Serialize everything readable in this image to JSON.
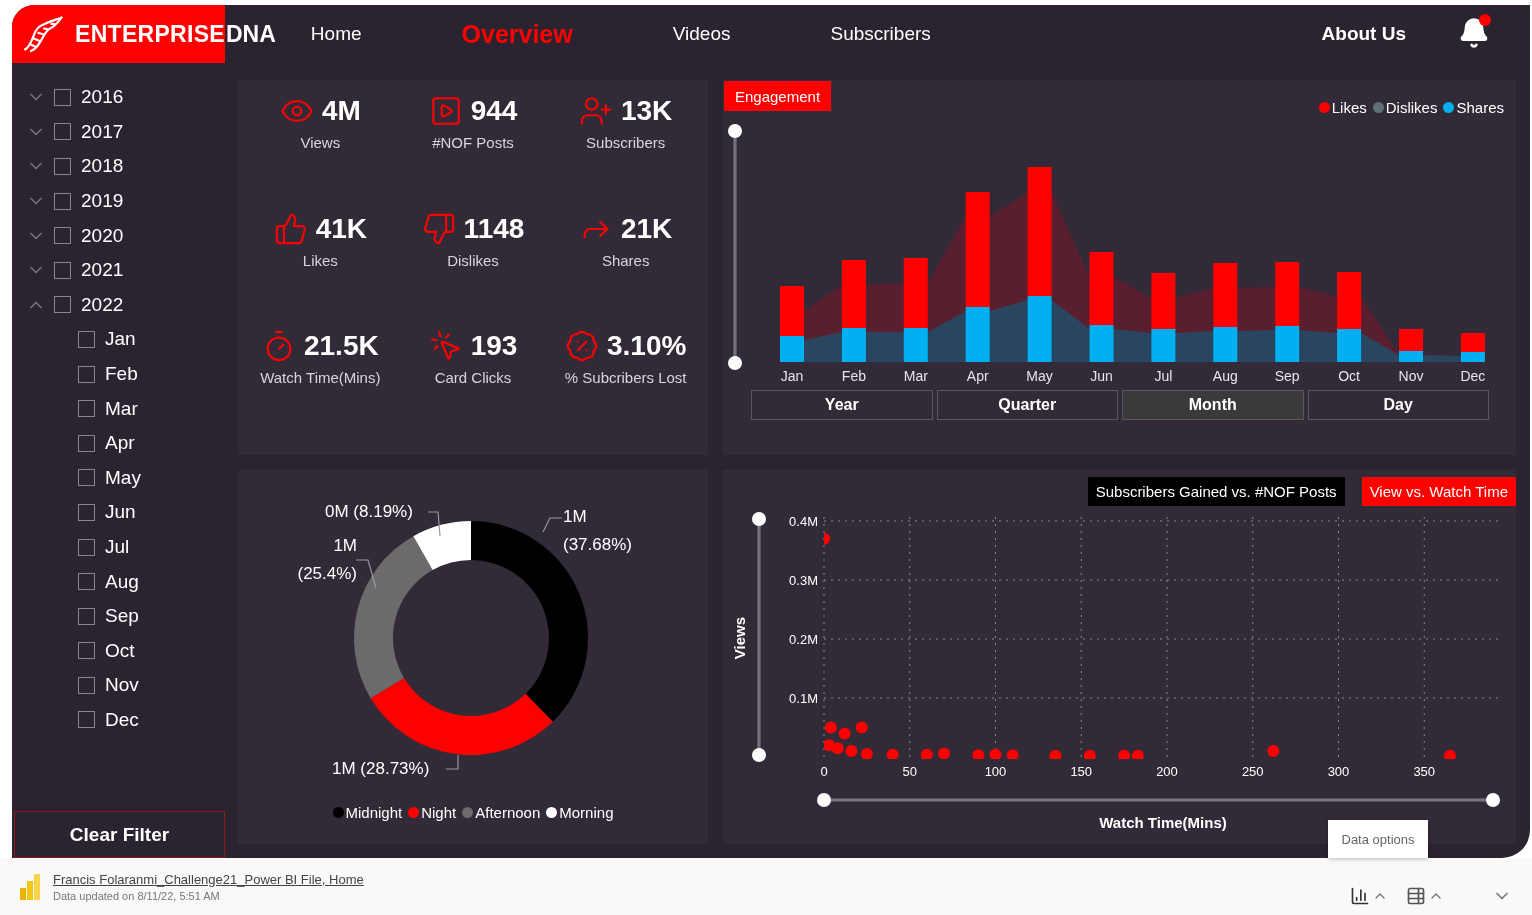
{
  "header": {
    "logo": {
      "text": "ENTERPRISE",
      "suffix": "DNA"
    },
    "nav": [
      {
        "label": "Home",
        "selected": false
      },
      {
        "label": "Overview",
        "selected": true
      },
      {
        "label": "Videos",
        "selected": false
      },
      {
        "label": "Subscribers",
        "selected": false
      }
    ],
    "about": "About Us",
    "notification": true
  },
  "sidebar": {
    "tree": [
      {
        "label": "2016",
        "checked": false,
        "expanded": false
      },
      {
        "label": "2017",
        "checked": false,
        "expanded": false
      },
      {
        "label": "2018",
        "checked": false,
        "expanded": false
      },
      {
        "label": "2019",
        "checked": false,
        "expanded": false
      },
      {
        "label": "2020",
        "checked": false,
        "expanded": false
      },
      {
        "label": "2021",
        "checked": false,
        "expanded": false
      },
      {
        "label": "2022",
        "checked": false,
        "expanded": true,
        "children": [
          {
            "label": "Jan",
            "checked": false
          },
          {
            "label": "Feb",
            "checked": false
          },
          {
            "label": "Mar",
            "checked": false
          },
          {
            "label": "Apr",
            "checked": false
          },
          {
            "label": "May",
            "checked": false
          },
          {
            "label": "Jun",
            "checked": false
          },
          {
            "label": "Jul",
            "checked": false
          },
          {
            "label": "Aug",
            "checked": false
          },
          {
            "label": "Sep",
            "checked": false
          },
          {
            "label": "Oct",
            "checked": false
          },
          {
            "label": "Nov",
            "checked": false
          },
          {
            "label": "Dec",
            "checked": false
          }
        ]
      }
    ],
    "clear_button": "Clear Filter"
  },
  "kpis": [
    {
      "kind": "views",
      "value": "4M",
      "label": "Views"
    },
    {
      "kind": "posts",
      "value": "944",
      "label": "#NOF Posts"
    },
    {
      "kind": "subscribers",
      "value": "13K",
      "label": "Subscribers"
    },
    {
      "kind": "likes",
      "value": "41K",
      "label": "Likes"
    },
    {
      "kind": "dislikes",
      "value": "1148",
      "label": "Dislikes"
    },
    {
      "kind": "shares",
      "value": "21K",
      "label": "Shares"
    },
    {
      "kind": "watch",
      "value": "21.5K",
      "label": "Watch Time(Mins)"
    },
    {
      "kind": "clicks",
      "value": "193",
      "label": "Card Clicks"
    },
    {
      "kind": "lost",
      "value": "3.10%",
      "label": "% Subcribers Lost"
    }
  ],
  "engagement": {
    "title": "Engagement",
    "legend": [
      {
        "label": "Likes",
        "color": "#ff0000"
      },
      {
        "label": "Dislikes",
        "color": "#5f7178"
      },
      {
        "label": "Shares",
        "color": "#00b0f0"
      }
    ],
    "months": [
      "Jan",
      "Feb",
      "Mar",
      "Apr",
      "May",
      "Jun",
      "Jul",
      "Aug",
      "Sep",
      "Oct",
      "Nov",
      "Dec"
    ],
    "periods": [
      {
        "label": "Year",
        "selected": false
      },
      {
        "label": "Quarter",
        "selected": false
      },
      {
        "label": "Month",
        "selected": true
      },
      {
        "label": "Day",
        "selected": false
      }
    ]
  },
  "time_of_day": {
    "chart_data": {
      "type": "donut",
      "categories": [
        "Midnight",
        "Night",
        "Afternoon",
        "Morning"
      ],
      "values": [
        37.68,
        28.73,
        25.4,
        8.19
      ],
      "colors": [
        "#000000",
        "#ff0000",
        "#6b6b6b",
        "#ffffff"
      ],
      "value_labels": [
        "1M (37.68%)",
        "1M (28.73%)",
        "1M (25.4%)",
        "0M (8.19%)"
      ]
    }
  },
  "scatter": {
    "tabs": [
      {
        "label": "Subscribers Gained vs. #NOF Posts",
        "selected": false
      },
      {
        "label": "View vs. Watch Time",
        "selected": true
      }
    ],
    "chart_data": {
      "type": "scatter",
      "xlabel": "Watch Time(Mins)",
      "ylabel": "Views",
      "x": [
        0,
        4,
        12,
        22,
        3,
        8,
        16,
        25,
        40,
        60,
        70,
        90,
        100,
        110,
        135,
        155,
        175,
        183,
        262,
        365
      ],
      "values": [
        370000,
        50000,
        40000,
        50000,
        20000,
        15000,
        10000,
        5000,
        4000,
        4000,
        6000,
        3000,
        4000,
        3000,
        2000,
        2000,
        2000,
        2000,
        10000,
        2000
      ],
      "color": "#ff0000",
      "grid": true,
      "xlim": [
        0,
        393
      ],
      "ylim": [
        0,
        400000
      ],
      "xticks": [
        0,
        50,
        100,
        150,
        200,
        250,
        300,
        350
      ],
      "yticks": [
        {
          "value": 100000,
          "label": "0.1M"
        },
        {
          "value": 200000,
          "label": "0.2M"
        },
        {
          "value": 300000,
          "label": "0.3M"
        },
        {
          "value": 400000,
          "label": "0.4M"
        }
      ]
    }
  },
  "footer": {
    "file_link": "Francis Folaranmi_Challenge21_Power BI File, Home",
    "updated": "Data updated on 8/11/22, 5:51 AM",
    "tooltip": "Data options"
  }
}
